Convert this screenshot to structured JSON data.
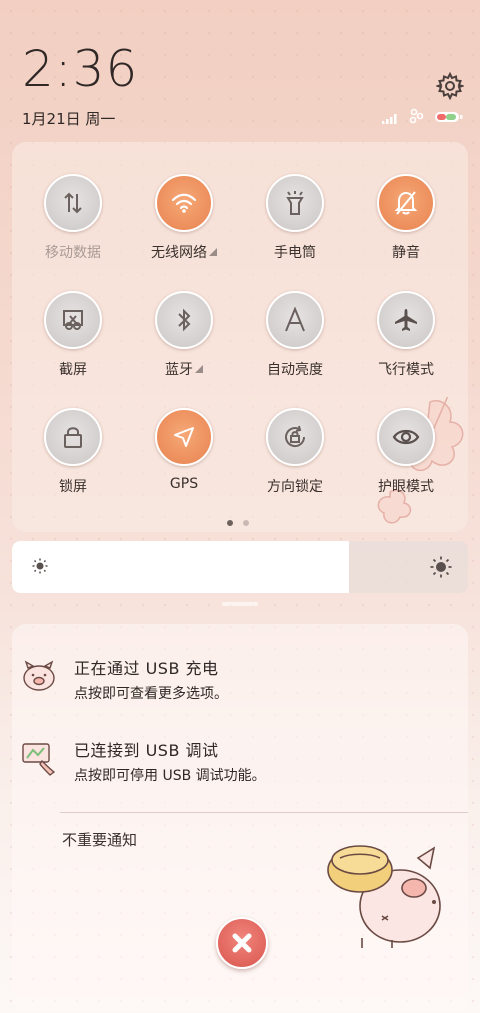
{
  "status": {
    "time": "2:36",
    "date": "1月21日 周一"
  },
  "quick_settings": {
    "tiles": [
      {
        "label": "移动数据",
        "icon": "data-transfer-icon",
        "active": false,
        "dimmed": true
      },
      {
        "label": "无线网络",
        "icon": "wifi-icon",
        "active": true,
        "expandable": true
      },
      {
        "label": "手电筒",
        "icon": "flashlight-icon",
        "active": false
      },
      {
        "label": "静音",
        "icon": "bell-off-icon",
        "active": true
      },
      {
        "label": "截屏",
        "icon": "screenshot-icon",
        "active": false
      },
      {
        "label": "蓝牙",
        "icon": "bluetooth-icon",
        "active": false,
        "expandable": true
      },
      {
        "label": "自动亮度",
        "icon": "auto-brightness-icon",
        "active": false
      },
      {
        "label": "飞行模式",
        "icon": "airplane-icon",
        "active": false
      },
      {
        "label": "锁屏",
        "icon": "lock-icon",
        "active": false
      },
      {
        "label": "GPS",
        "icon": "location-arrow-icon",
        "active": true
      },
      {
        "label": "方向锁定",
        "icon": "rotation-lock-icon",
        "active": false
      },
      {
        "label": "护眼模式",
        "icon": "eye-icon",
        "active": false
      }
    ],
    "page_count": 2,
    "current_page": 1
  },
  "brightness": {
    "level_fraction": 0.74
  },
  "notifications": [
    {
      "title": "正在通过  USB  充电",
      "subtitle": "点按即可查看更多选项。",
      "icon": "pig-charging-icon"
    },
    {
      "title": "已连接到  USB  调试",
      "subtitle": "点按即可停用 USB 调试功能。",
      "icon": "usb-debug-icon"
    }
  ],
  "minor_notifications_label": "不重要通知",
  "colors": {
    "accent_on": "#ec8e5b",
    "tile_off": "#d3cfce",
    "clear_button": "#e0645c"
  }
}
